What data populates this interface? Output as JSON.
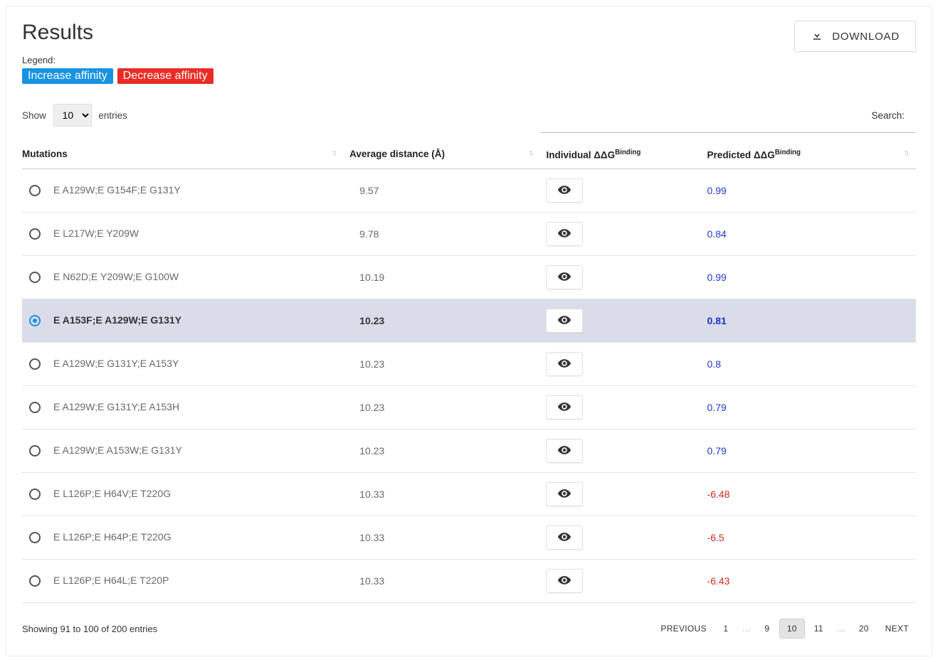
{
  "title": "Results",
  "legend": {
    "label": "Legend:",
    "increase": "Increase affinity",
    "decrease": "Decrease affinity"
  },
  "download_label": "DOWNLOAD",
  "controls": {
    "show": "Show",
    "entries": "entries",
    "page_size": "10",
    "search_label": "Search:"
  },
  "columns": {
    "mutations": "Mutations",
    "avg_distance": "Average distance (Å)",
    "individual_prefix": "Individual ΔΔG",
    "individual_sup": "Binding",
    "predicted_prefix": "Predicted ΔΔG",
    "predicted_sup": "Binding"
  },
  "rows": [
    {
      "selected": false,
      "mutations": "E A129W;E G154F;E G131Y",
      "distance": "9.57",
      "predicted": "0.99",
      "sign": "pos"
    },
    {
      "selected": false,
      "mutations": "E L217W;E Y209W",
      "distance": "9.78",
      "predicted": "0.84",
      "sign": "pos"
    },
    {
      "selected": false,
      "mutations": "E N62D;E Y209W;E G100W",
      "distance": "10.19",
      "predicted": "0.99",
      "sign": "pos"
    },
    {
      "selected": true,
      "mutations": "E A153F;E A129W;E G131Y",
      "distance": "10.23",
      "predicted": "0.81",
      "sign": "pos"
    },
    {
      "selected": false,
      "mutations": "E A129W;E G131Y;E A153Y",
      "distance": "10.23",
      "predicted": "0.8",
      "sign": "pos"
    },
    {
      "selected": false,
      "mutations": "E A129W;E G131Y;E A153H",
      "distance": "10.23",
      "predicted": "0.79",
      "sign": "pos"
    },
    {
      "selected": false,
      "mutations": "E A129W;E A153W;E G131Y",
      "distance": "10.23",
      "predicted": "0.79",
      "sign": "pos"
    },
    {
      "selected": false,
      "mutations": "E L126P;E H64V;E T220G",
      "distance": "10.33",
      "predicted": "-6.48",
      "sign": "neg"
    },
    {
      "selected": false,
      "mutations": "E L126P;E H64P;E T220G",
      "distance": "10.33",
      "predicted": "-6.5",
      "sign": "neg"
    },
    {
      "selected": false,
      "mutations": "E L126P;E H64L;E T220P",
      "distance": "10.33",
      "predicted": "-6.43",
      "sign": "neg"
    }
  ],
  "footer": {
    "info": "Showing 91 to 100 of 200 entries",
    "previous": "PREVIOUS",
    "next": "NEXT",
    "pages_left": [
      "1"
    ],
    "pages_mid": [
      "9",
      "10",
      "11"
    ],
    "pages_right": [
      "20"
    ],
    "current": "10",
    "ellipsis": "…"
  }
}
